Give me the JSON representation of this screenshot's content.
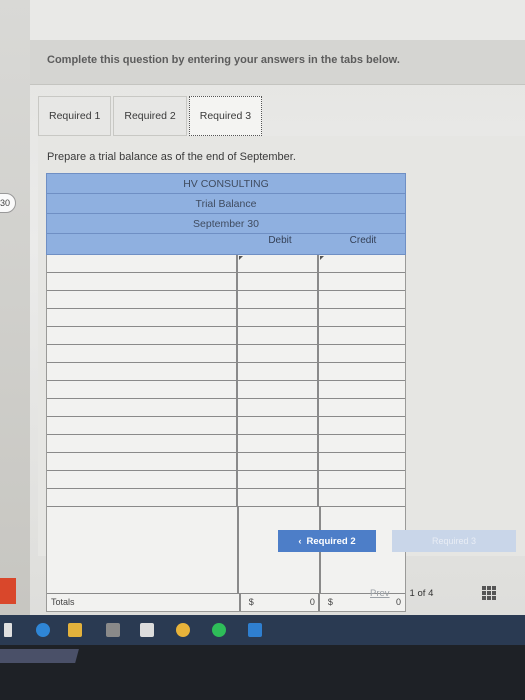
{
  "header": {
    "instruction": "Complete this question by entering your answers in the tabs below."
  },
  "tabs": [
    {
      "label": "Required 1"
    },
    {
      "label": "Required 2"
    },
    {
      "label": "Required 3"
    }
  ],
  "prompt": "Prepare a trial balance as of the end of September.",
  "trial_balance": {
    "company": "HV CONSULTING",
    "title": "Trial Balance",
    "date": "September 30",
    "col_debit": "Debit",
    "col_credit": "Credit",
    "totals_label": "Totals",
    "currency": "$",
    "debit_total": "0",
    "credit_total": "0"
  },
  "nav": {
    "prev_button": "Required 2",
    "next_button": "Required 3",
    "prev_link": "Prev",
    "page_current": "1",
    "page_of": "of",
    "page_total": "4"
  },
  "side": {
    "badge": "30"
  },
  "colors": {
    "accent": "#4d7ec8",
    "header_blue": "#8fb0e0"
  }
}
